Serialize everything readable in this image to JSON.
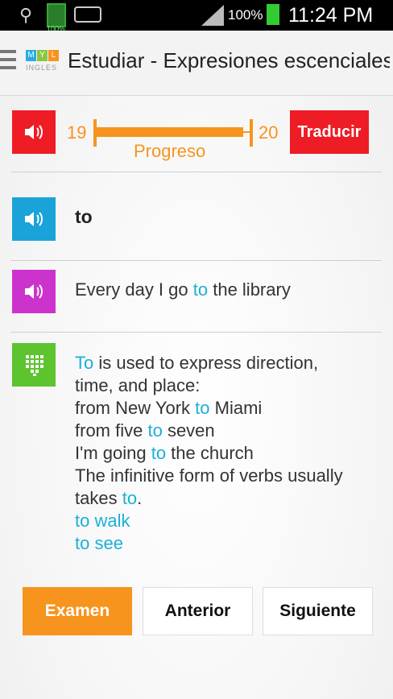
{
  "status_bar": {
    "battery_small_label": "100%",
    "battery_percent": "100%",
    "time": "11:24 PM"
  },
  "app_bar": {
    "logo_letters": [
      "M",
      "Y",
      "L"
    ],
    "logo_subtitle": "INGLES",
    "title": "Estudiar - Expresiones escenciales"
  },
  "progress": {
    "current": "19",
    "total": "20",
    "label": "Progreso",
    "fraction": 0.95
  },
  "translate_button": "Traducir",
  "word": "to",
  "sentence": {
    "before": "Every day I go ",
    "highlight": "to",
    "after": " the library"
  },
  "explanation": {
    "lines": [
      [
        {
          "t": "To",
          "h": true
        },
        {
          "t": " is used to express direction,",
          "h": false
        }
      ],
      [
        {
          "t": "time, and place:",
          "h": false
        }
      ],
      [
        {
          "t": "from New York ",
          "h": false
        },
        {
          "t": "to",
          "h": true
        },
        {
          "t": " Miami",
          "h": false
        }
      ],
      [
        {
          "t": "from five ",
          "h": false
        },
        {
          "t": "to",
          "h": true
        },
        {
          "t": " seven",
          "h": false
        }
      ],
      [
        {
          "t": "I'm going ",
          "h": false
        },
        {
          "t": "to",
          "h": true
        },
        {
          "t": " the church",
          "h": false
        }
      ],
      [
        {
          "t": "The infinitive form of verbs usually",
          "h": false
        }
      ],
      [
        {
          "t": "takes ",
          "h": false
        },
        {
          "t": "to",
          "h": true
        },
        {
          "t": ".",
          "h": false
        }
      ],
      [
        {
          "t": "to walk",
          "h": true
        }
      ],
      [
        {
          "t": "to see",
          "h": true
        }
      ]
    ]
  },
  "buttons": {
    "exam": "Examen",
    "previous": "Anterior",
    "next": "Siguiente"
  },
  "colors": {
    "accent_orange": "#f7941d",
    "red": "#ee1c24",
    "blue": "#1aa3d9",
    "magenta": "#cc33cc",
    "green": "#5dc32f",
    "highlight": "#1ab0d8"
  },
  "icons": {
    "audio": "speaker-icon",
    "grammar": "keypad-icon"
  }
}
